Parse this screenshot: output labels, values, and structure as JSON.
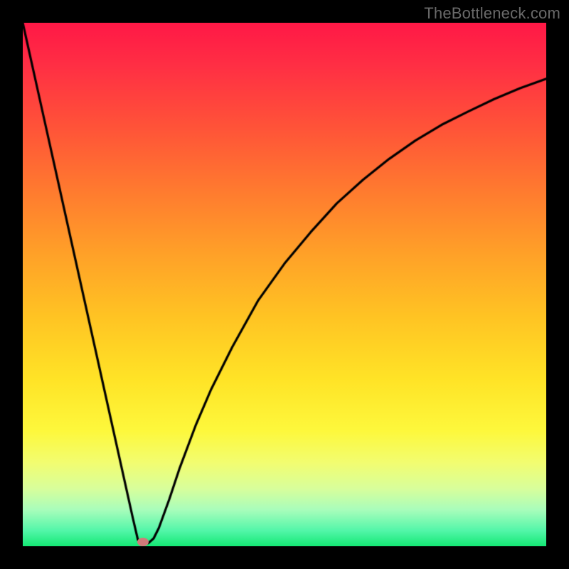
{
  "watermark": "TheBottleneck.com",
  "chart_data": {
    "type": "line",
    "title": "",
    "xlabel": "",
    "ylabel": "",
    "xlim": [
      0,
      100
    ],
    "ylim": [
      0,
      100
    ],
    "grid": false,
    "legend": false,
    "series": [
      {
        "name": "curve",
        "x": [
          0,
          2,
          4,
          6,
          8,
          10,
          12,
          14,
          16,
          18,
          20,
          21,
          22,
          23,
          24,
          25,
          26,
          28,
          30,
          33,
          36,
          40,
          45,
          50,
          55,
          60,
          65,
          70,
          75,
          80,
          85,
          90,
          95,
          100
        ],
        "y": [
          100,
          91,
          82,
          73,
          64,
          55,
          46,
          37,
          28,
          19,
          10,
          5.5,
          1.2,
          0.5,
          0.6,
          1.5,
          3.5,
          9,
          15,
          23,
          30,
          38,
          47,
          54,
          60,
          65.5,
          70,
          74,
          77.5,
          80.5,
          83,
          85.4,
          87.5,
          89.3
        ]
      }
    ],
    "marker": {
      "x": 23,
      "y": 0.8
    },
    "background_gradient": {
      "stops": [
        {
          "pos": 0,
          "color": "#ff1846"
        },
        {
          "pos": 0.5,
          "color": "#ffc323"
        },
        {
          "pos": 0.85,
          "color": "#f2fd70"
        },
        {
          "pos": 1,
          "color": "#14e874"
        }
      ]
    }
  }
}
